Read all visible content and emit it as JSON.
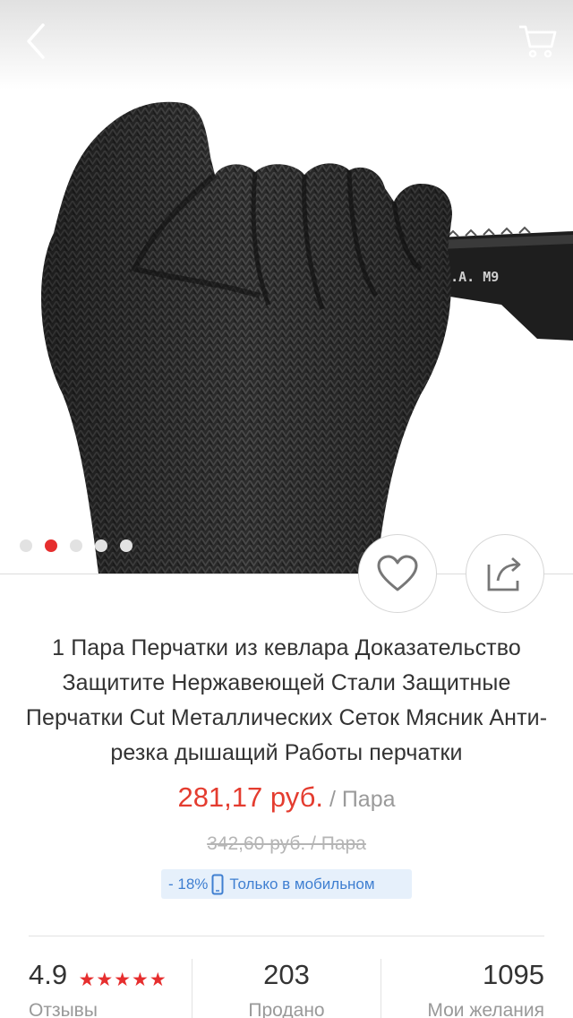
{
  "header": {
    "back_icon": "chevron-left-icon",
    "cart_icon": "shopping-cart-icon"
  },
  "gallery": {
    "image_alt": "Black knitted cut-resistant glove gripping a knife",
    "knife_marking": "U.S.A. M9",
    "dots_total": 5,
    "active_dot": 2
  },
  "actions": {
    "favorite_icon": "heart-icon",
    "share_icon": "share-icon"
  },
  "product": {
    "title": "1 Пара Перчатки из кевлара Доказательство Защитите Нержавеющей Стали Защитные Перчатки Cut Металлических Сеток Мясник Анти-резка дышащий Работы перчатки",
    "price": "281,17 руб.",
    "price_unit": " / Пара",
    "old_price": "342,60 руб.  / Пара",
    "discount": "- 18%",
    "mobile_only": "Только в мобильном"
  },
  "stats": {
    "rating": "4.9",
    "rating_label": "Отзывы",
    "rating_stars": 5,
    "sold": "203",
    "sold_label": "Продано",
    "wishlist": "1095",
    "wishlist_label": "Мои желания"
  },
  "colors": {
    "accent": "#e43c2f",
    "promo_blue": "#3f7fd1",
    "promo_bg": "#e6f0fb"
  }
}
